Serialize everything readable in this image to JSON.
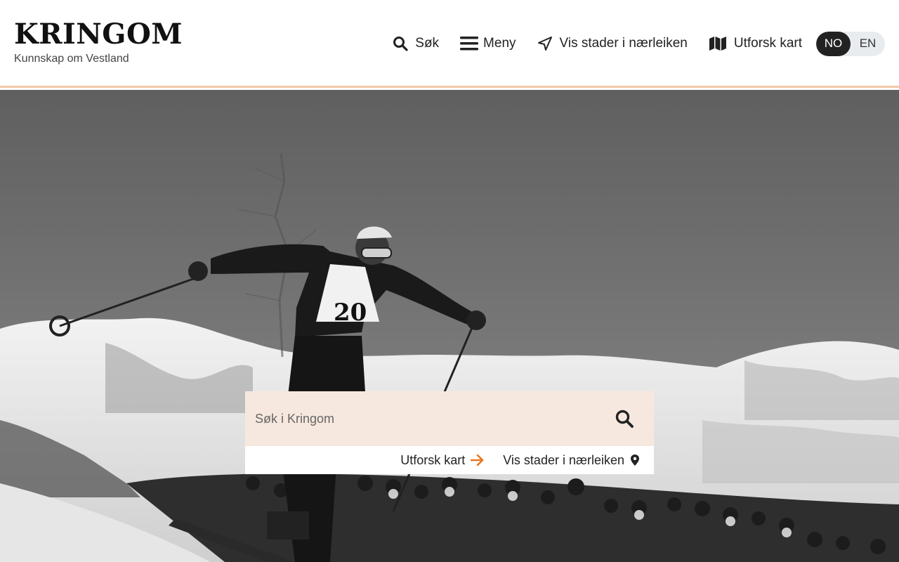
{
  "header": {
    "title": "KRINGOM",
    "subtitle": "Kunnskap om Vestland"
  },
  "nav": {
    "search_label": "Søk",
    "menu_label": "Meny",
    "nearby_label": "Vis stader i nærleiken",
    "map_label": "Utforsk kart",
    "lang_no": "NO",
    "lang_en": "EN"
  },
  "hero": {
    "bib_number": "20"
  },
  "search": {
    "placeholder": "Søk i Kringom",
    "explore_map_label": "Utforsk kart",
    "nearby_label": "Vis stader i nærleiken"
  },
  "colors": {
    "accent": "#e87722",
    "search_bg": "#f7e8df",
    "header_border": "#f0c9a8"
  },
  "icons": [
    "search-icon",
    "menu-icon",
    "navigation-arrow-icon",
    "map-icon",
    "arrow-right-icon",
    "map-pin-icon"
  ]
}
